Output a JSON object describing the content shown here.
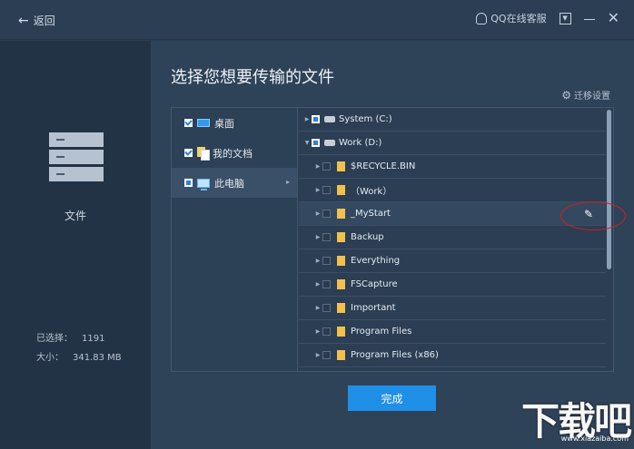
{
  "titlebar": {
    "back_label": "返回",
    "support_label": "QQ在线客服"
  },
  "sidebar": {
    "category_label": "文件",
    "selected_label": "已选择：",
    "selected_value": "1191",
    "size_label": "大小：",
    "size_value": "341.83 MB"
  },
  "main": {
    "title": "选择您想要传输的文件",
    "migrate_settings": "迁移设置",
    "done_button": "完成"
  },
  "locations": [
    {
      "label": "桌面",
      "state": "checked",
      "icon": "desktop-icon"
    },
    {
      "label": "我的文档",
      "state": "checked",
      "icon": "documents-icon"
    },
    {
      "label": "此电脑",
      "state": "partial",
      "icon": "computer-icon"
    }
  ],
  "tree": [
    {
      "label": "System (C:)",
      "level": 0,
      "state": "partial",
      "icon": "drive-icon",
      "expanded": false
    },
    {
      "label": "Work (D:)",
      "level": 0,
      "state": "partial",
      "icon": "drive-icon",
      "expanded": true
    },
    {
      "label": "$RECYCLE.BIN",
      "level": 1,
      "state": "off",
      "icon": "folder-icon"
    },
    {
      "label": "（Work）",
      "level": 1,
      "state": "off",
      "icon": "folder-icon"
    },
    {
      "label": "_MyStart",
      "level": 1,
      "state": "off",
      "icon": "folder-icon"
    },
    {
      "label": "Backup",
      "level": 1,
      "state": "off",
      "icon": "folder-icon"
    },
    {
      "label": "Everything",
      "level": 1,
      "state": "off",
      "icon": "folder-icon"
    },
    {
      "label": "FSCapture",
      "level": 1,
      "state": "off",
      "icon": "folder-icon"
    },
    {
      "label": "Important",
      "level": 1,
      "state": "off",
      "icon": "folder-icon"
    },
    {
      "label": "Program Files",
      "level": 1,
      "state": "off",
      "icon": "folder-icon"
    },
    {
      "label": "Program Files (x86)",
      "level": 1,
      "state": "off",
      "icon": "folder-icon"
    }
  ],
  "watermark": {
    "logo_text": "下载吧",
    "url": "www.xiazaiba.com"
  },
  "colors": {
    "accent": "#1f8fe8",
    "highlight_oval": "#d21f1f"
  }
}
